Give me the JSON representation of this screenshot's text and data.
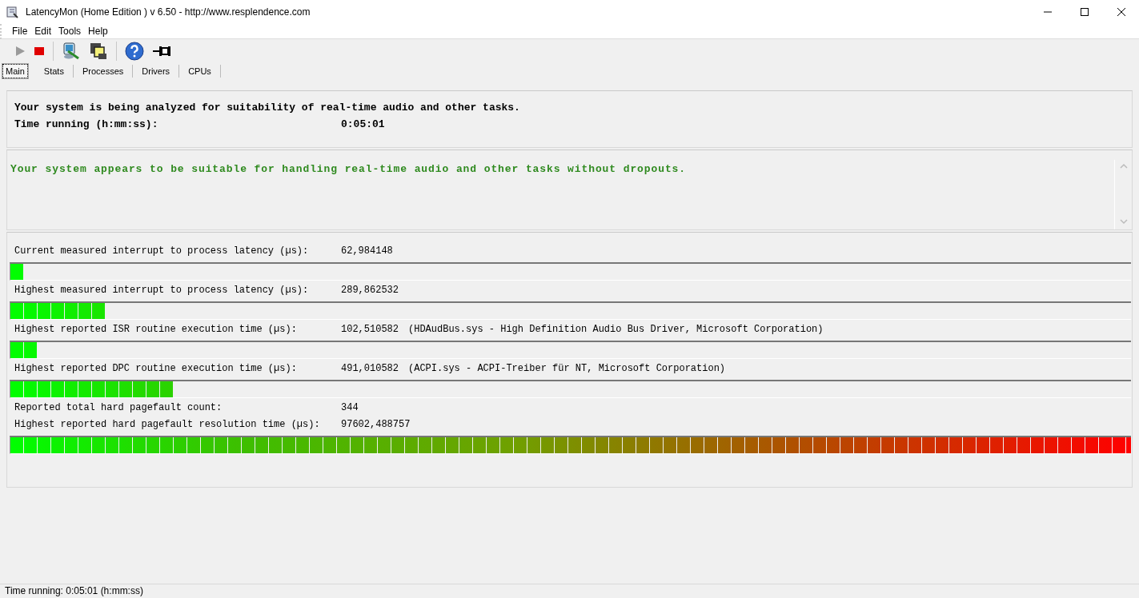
{
  "window": {
    "title": "LatencyMon  (Home Edition )  v 6.50 - http://www.resplendence.com"
  },
  "menu": [
    "File",
    "Edit",
    "Tools",
    "Help"
  ],
  "tabs": [
    {
      "label": "Main",
      "selected": true
    },
    {
      "label": "Stats",
      "selected": false
    },
    {
      "label": "Processes",
      "selected": false
    },
    {
      "label": "Drivers",
      "selected": false
    },
    {
      "label": "CPUs",
      "selected": false
    }
  ],
  "analysis": {
    "message": "Your system is being analyzed for suitability of real-time audio and other tasks.",
    "time_label": "Time running (h:mm:ss):",
    "time_value": "0:05:01"
  },
  "verdict": "Your system appears to be suitable for handling real-time audio and other tasks without dropouts.",
  "metrics": [
    {
      "kind": "meter",
      "label": "Current measured interrupt to process latency (µs):",
      "value": "62,984148",
      "level": 0.012
    },
    {
      "kind": "meter",
      "label": "Highest measured interrupt to process latency (µs):",
      "value": "289,862532",
      "level": 0.085
    },
    {
      "kind": "meter",
      "label": "Highest reported ISR routine execution time (µs):",
      "value": "102,510582",
      "detail": "(HDAudBus.sys - High Definition Audio Bus Driver, Microsoft Corporation)",
      "level": 0.024
    },
    {
      "kind": "meter",
      "label": "Highest reported DPC routine execution time (µs):",
      "value": "491,010582",
      "detail": "(ACPI.sys - ACPI-Treiber für NT, Microsoft Corporation)",
      "level": 0.146
    },
    {
      "kind": "text",
      "label": "Reported total hard pagefault count:",
      "value": "344"
    },
    {
      "kind": "meter",
      "label": "Highest reported hard pagefault resolution time (µs):",
      "value": "97602,488757",
      "level": 1.0
    }
  ],
  "status_bar": "Time running: 0:05:01  (h:mm:ss)"
}
